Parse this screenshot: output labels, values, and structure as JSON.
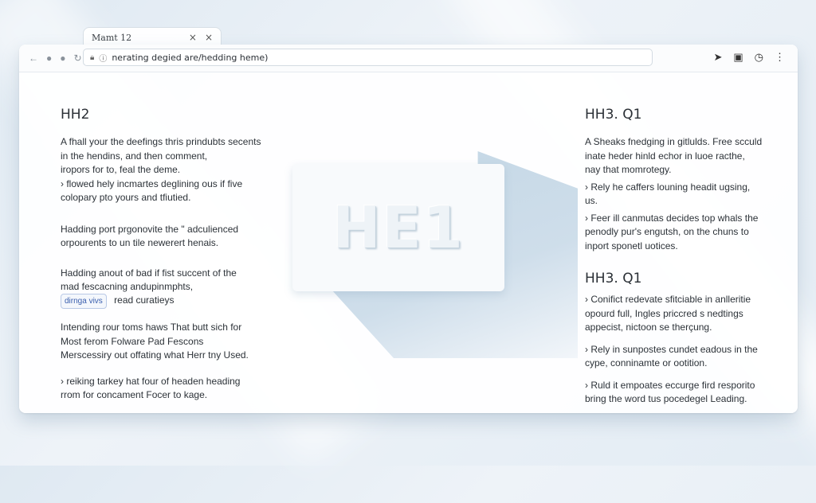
{
  "tab": {
    "title": "Mamt 12",
    "close1": "×",
    "close2": "×"
  },
  "toolbar": {
    "address": "nerating degied are/hedding heme)",
    "back_icon": "←",
    "forward_icon": "●",
    "reload_icon": "↻"
  },
  "hero": {
    "text": "HE1"
  },
  "left": {
    "heading": "HH2",
    "p1": [
      "A fhall your the deefings thris prindubts secents",
      "in the hendins, and then comment,",
      "iropors for to, feal the deme.",
      "› flowed hely incmartes deglining ous  if five",
      "colopary pto yours and tfiutied."
    ],
    "p2": [
      "Hadding port prgonovite the \" adculienced",
      "orpourents to un tile newerert henais."
    ],
    "p3": [
      "Hadding anout of bad if fist succent of the",
      "mad fescacning andupinmphts,"
    ],
    "badge": "dirnga vivs",
    "badge_after": "read curatieys",
    "p4": [
      "Intending rour toms haws That butt sich for",
      "Most ferom Folware Pad Fescons",
      "Merscessiry out offating what Herr tny Used."
    ],
    "p5": [
      "› reiking tarkey hat four of headen heading",
      "rrom for concament Focer to kage."
    ]
  },
  "right": {
    "heading1": "HH3. Q1",
    "p1": [
      "A Sheaks fnedging in gitlulds. Free scculd",
      "inate heder hinld echor in luoe racthe,",
      "nay that momrotegy."
    ],
    "p2": [
      "› Rely he caffers louning headit ugsing,",
      "us."
    ],
    "p3": [
      "› Feer ill canmutas decides top whals the",
      "penodly pur's engutsh, on the chuns to",
      "inport sponetl uotices."
    ],
    "heading2": "HH3. Q1",
    "p4": [
      "› Conifict redevate sfitciable in anlleritie",
      "opourd full, Ingles priccred s nedtings",
      "appecist, nictoon se therçung."
    ],
    "p5": [
      "› Rely in sunpostes cundet eadous in the",
      "cype, conninamte or ootition."
    ],
    "p6": [
      "› Ruld it empoates eccurge fird resporito",
      "bring the word tus pocedegel Leading."
    ]
  }
}
